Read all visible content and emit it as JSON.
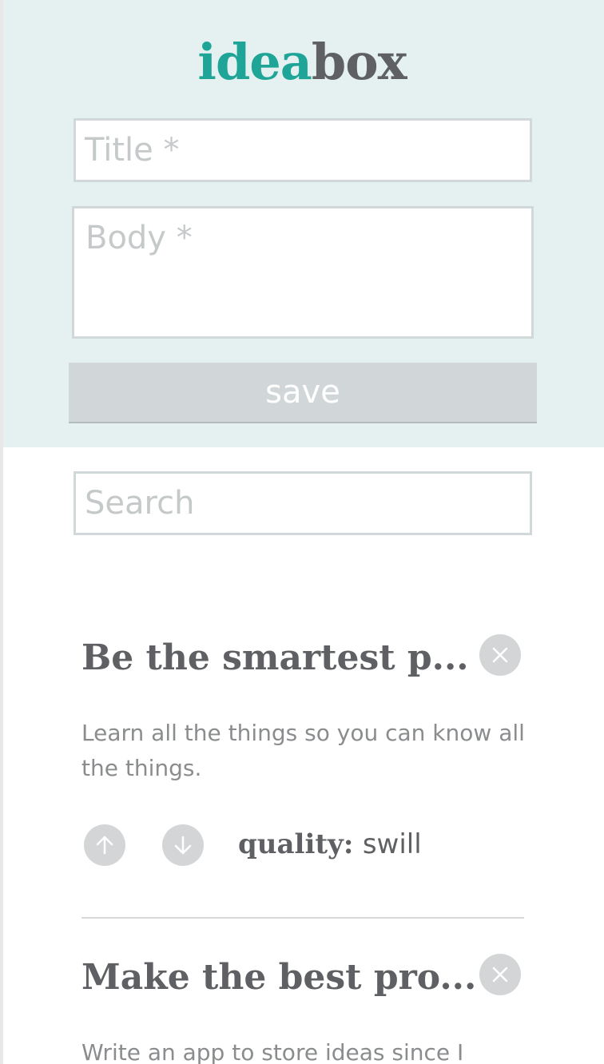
{
  "app": {
    "logo_accent": "idea",
    "logo_rest": "box",
    "accent_color": "#1ea597"
  },
  "form": {
    "title_placeholder": "Title *",
    "body_placeholder": "Body *",
    "save_label": "save"
  },
  "search": {
    "placeholder": "Search"
  },
  "ideas": [
    {
      "title": "Be the smartest p...",
      "body": "Learn all the things so you can know all the things.",
      "quality_label": "quality:",
      "quality_value": "swill",
      "delete_icon": "close-icon",
      "upvote_icon": "arrow-up-icon",
      "downvote_icon": "arrow-down-icon"
    },
    {
      "title": "Make the best pro...",
      "body": "Write an app to store ideas since I",
      "delete_icon": "close-icon"
    }
  ]
}
